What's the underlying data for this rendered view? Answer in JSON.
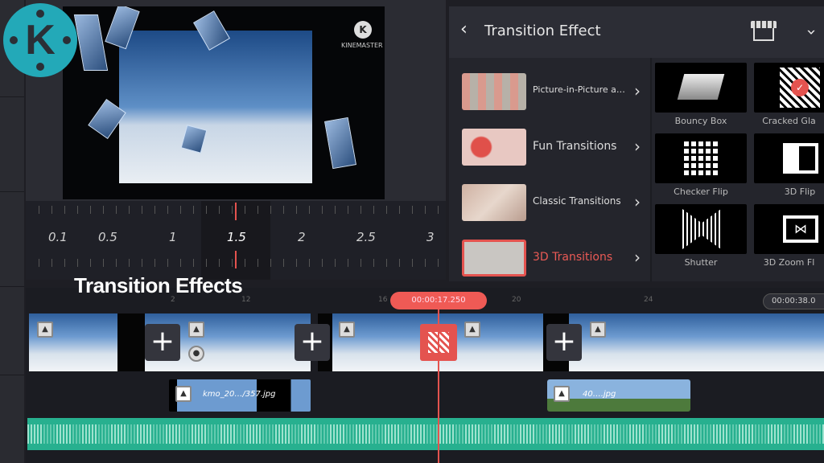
{
  "logo": {
    "letter": "K",
    "color": "#23a9b8"
  },
  "preview": {
    "watermark": "KINEMASTER"
  },
  "ruler": {
    "labels": [
      "0.1",
      "0.5",
      "1",
      "1.5",
      "2",
      "2.5",
      "3"
    ],
    "selected": "1.5"
  },
  "panel": {
    "title": "Transition Effect",
    "back_icon": "chevron-left-icon",
    "store_icon": "store-icon",
    "collapse_icon": "chevron-down-icon",
    "categories": [
      {
        "label": "Picture-in-Picture a…",
        "selected": false
      },
      {
        "label": "Fun Transitions",
        "selected": false
      },
      {
        "label": "Classic Transitions",
        "selected": false
      },
      {
        "label": "3D Transitions",
        "selected": true
      }
    ],
    "effects": [
      {
        "label": "Bouncy Box"
      },
      {
        "label": "Cracked Gla",
        "selected": true
      },
      {
        "label": "Checker Flip"
      },
      {
        "label": "3D Flip"
      },
      {
        "label": "Shutter"
      },
      {
        "label": "3D Zoom Fl"
      }
    ]
  },
  "timeline": {
    "ruler_labels": [
      "2",
      "12",
      "16",
      "20",
      "24"
    ],
    "playhead_time": "00:00:17.250",
    "end_time": "00:00:38.0",
    "layers": [
      {
        "label": "kmo_20…/357.jpg"
      },
      {
        "label": "40….jpg"
      }
    ]
  },
  "overlay_caption": "Transition Effects",
  "colors": {
    "accent": "#ef5a55",
    "audio": "#27b08f"
  }
}
